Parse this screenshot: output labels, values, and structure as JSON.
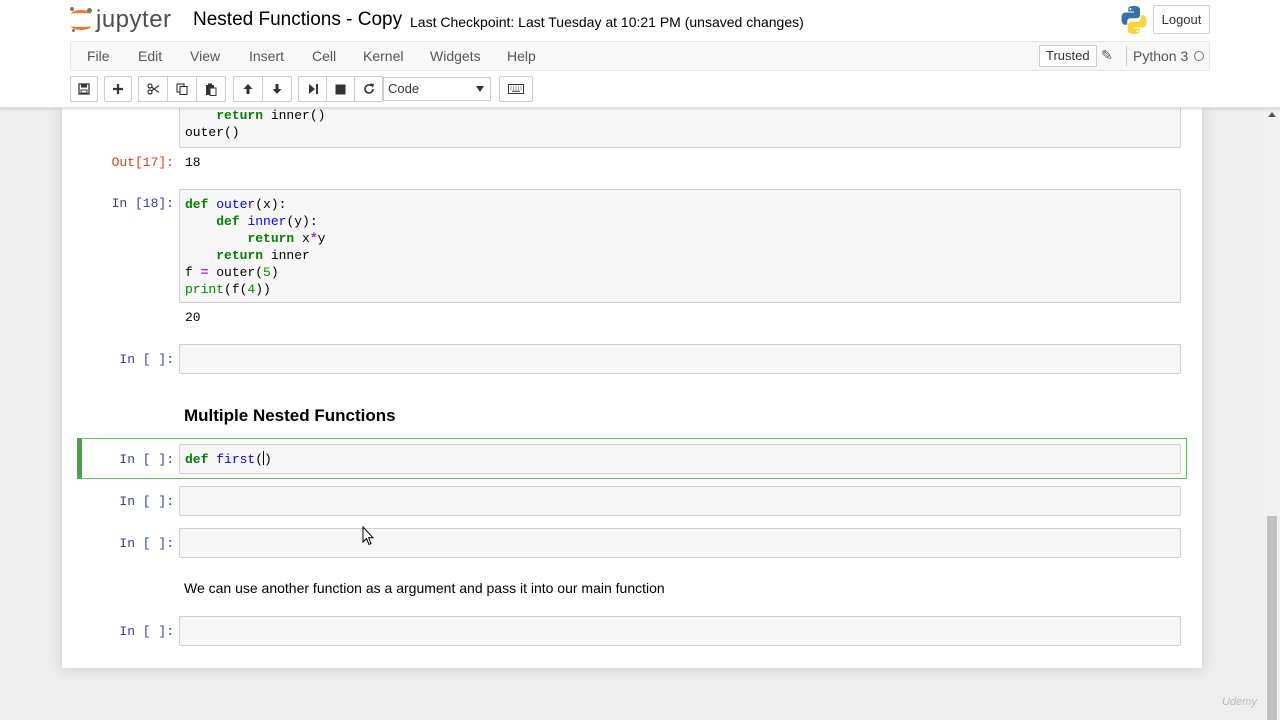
{
  "app": {
    "logo_text": "jupyter",
    "notebook_title": "Nested Functions - Copy",
    "checkpoint": "Last Checkpoint: Last Tuesday at 10:21 PM (unsaved changes)",
    "logout_label": "Logout",
    "trusted_label": "Trusted",
    "kernel_name": "Python 3"
  },
  "menu": [
    "File",
    "Edit",
    "View",
    "Insert",
    "Cell",
    "Kernel",
    "Widgets",
    "Help"
  ],
  "toolbar": {
    "cell_type": "Code",
    "buttons": [
      "save-icon",
      "plus-icon",
      "cut-icon",
      "copy-icon",
      "paste-icon",
      "arrow-up-icon",
      "arrow-down-icon",
      "run-icon",
      "stop-icon",
      "restart-icon",
      "keyboard-icon"
    ]
  },
  "cells": {
    "c17": {
      "code_lines": [
        "    return inner()",
        "outer()"
      ],
      "out_prompt": "Out[17]:",
      "output": "18"
    },
    "c18": {
      "prompt": "In [18]:",
      "output": "20"
    },
    "empty1": {
      "prompt": "In [ ]:"
    },
    "heading": "Multiple Nested Functions",
    "active": {
      "prompt": "In [ ]:",
      "code": "def first("
    },
    "empty2": {
      "prompt": "In [ ]:"
    },
    "empty3": {
      "prompt": "In [ ]:"
    },
    "markdown_text": "We can use another function as a argument and pass it into our main function",
    "empty4": {
      "prompt": "In [ ]:"
    }
  },
  "watermark": "Udemy"
}
